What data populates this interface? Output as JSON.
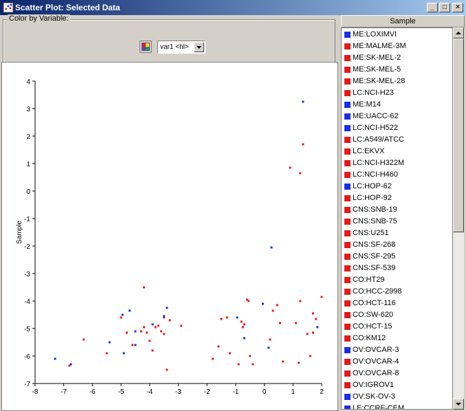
{
  "window": {
    "title": "Scatter Plot: Selected Data",
    "minimize": "_",
    "maximize": "□",
    "close": "×"
  },
  "color_by": {
    "label": "Color by Variable:",
    "selected": "var1 <hl>",
    "icon": "color-palette-icon"
  },
  "colors": {
    "red": "#e31a1a",
    "blue": "#1a2fe6"
  },
  "list": {
    "header": "Sample",
    "items": [
      {
        "label": "ME:LOXIMVI",
        "color": "blue"
      },
      {
        "label": "ME:MALME-3M",
        "color": "red"
      },
      {
        "label": "ME:SK-MEL-2",
        "color": "red"
      },
      {
        "label": "ME:SK-MEL-5",
        "color": "red"
      },
      {
        "label": "ME:SK-MEL-28",
        "color": "red"
      },
      {
        "label": "LC:NCI-H23",
        "color": "red"
      },
      {
        "label": "ME:M14",
        "color": "blue"
      },
      {
        "label": "ME:UACC-62",
        "color": "blue"
      },
      {
        "label": "LC:NCI-H522",
        "color": "blue"
      },
      {
        "label": "LC:A549/ATCC",
        "color": "red"
      },
      {
        "label": "LC:EKVX",
        "color": "red"
      },
      {
        "label": "LC:NCI-H322M",
        "color": "red"
      },
      {
        "label": "LC:NCI-H460",
        "color": "red"
      },
      {
        "label": "LC:HOP-62",
        "color": "blue"
      },
      {
        "label": "LC:HOP-92",
        "color": "red"
      },
      {
        "label": "CNS:SNB-19",
        "color": "red"
      },
      {
        "label": "CNS:SNB-75",
        "color": "red"
      },
      {
        "label": "CNS:U251",
        "color": "red"
      },
      {
        "label": "CNS:SF-268",
        "color": "red"
      },
      {
        "label": "CNS:SF-295",
        "color": "red"
      },
      {
        "label": "CNS:SF-539",
        "color": "red"
      },
      {
        "label": "CO:HT29",
        "color": "red"
      },
      {
        "label": "CO:HCC-2998",
        "color": "red"
      },
      {
        "label": "CO:HCT-116",
        "color": "red"
      },
      {
        "label": "CO:SW-620",
        "color": "red"
      },
      {
        "label": "CO:HCT-15",
        "color": "red"
      },
      {
        "label": "CO:KM12",
        "color": "red"
      },
      {
        "label": "OV:OVCAR-3",
        "color": "blue"
      },
      {
        "label": "OV:OVCAR-4",
        "color": "red"
      },
      {
        "label": "OV:OVCAR-8",
        "color": "red"
      },
      {
        "label": "OV:IGROV1",
        "color": "red"
      },
      {
        "label": "OV:SK-OV-3",
        "color": "blue"
      },
      {
        "label": "LE:CCRF-CEM",
        "color": "blue"
      }
    ]
  },
  "chart_data": {
    "type": "scatter",
    "ylabel": "Sample",
    "xlim": [
      -8,
      2
    ],
    "ylim": [
      -7,
      4
    ],
    "xticks": [
      "-8",
      "-7",
      "-6",
      "-5",
      "-4",
      "-3",
      "-2",
      "-1",
      "0",
      "1",
      "2"
    ],
    "yticks": [
      "4",
      "3",
      "2",
      "1",
      "0",
      "-1",
      "-2",
      "-3",
      "-4",
      "-5",
      "-6",
      "-7"
    ],
    "series": [
      {
        "color": "red",
        "points": [
          [
            -6.8,
            -6.35
          ],
          [
            -6.3,
            -5.4
          ],
          [
            -5.5,
            -5.9
          ],
          [
            -5.0,
            -4.6
          ],
          [
            -4.8,
            -5.15
          ],
          [
            -4.6,
            -5.6
          ],
          [
            -4.3,
            -5.1
          ],
          [
            -4.2,
            -3.5
          ],
          [
            -4.2,
            -4.95
          ],
          [
            -4.1,
            -5.15
          ],
          [
            -4.0,
            -5.45
          ],
          [
            -3.9,
            -5.8
          ],
          [
            -3.8,
            -4.95
          ],
          [
            -3.7,
            -4.9
          ],
          [
            -3.6,
            -5.1
          ],
          [
            -3.5,
            -4.6
          ],
          [
            -3.5,
            -5.2
          ],
          [
            -3.4,
            -6.5
          ],
          [
            -3.3,
            -4.7
          ],
          [
            -2.9,
            -4.9
          ],
          [
            -1.8,
            -6.1
          ],
          [
            -1.6,
            -5.65
          ],
          [
            -1.5,
            -4.65
          ],
          [
            -1.3,
            -4.6
          ],
          [
            -1.2,
            -5.9
          ],
          [
            -0.9,
            -6.3
          ],
          [
            -0.8,
            -4.75
          ],
          [
            -0.75,
            -4.95
          ],
          [
            -0.7,
            -4.85
          ],
          [
            -0.6,
            -3.95
          ],
          [
            -0.55,
            -4.0
          ],
          [
            -0.5,
            -6.0
          ],
          [
            -0.4,
            -6.3
          ],
          [
            0.2,
            -5.4
          ],
          [
            0.3,
            -4.35
          ],
          [
            0.45,
            -4.15
          ],
          [
            0.55,
            -4.8
          ],
          [
            0.65,
            -6.2
          ],
          [
            0.9,
            0.85
          ],
          [
            1.1,
            -4.8
          ],
          [
            1.2,
            -6.25
          ],
          [
            1.25,
            -4.0
          ],
          [
            1.25,
            0.65
          ],
          [
            1.35,
            1.7
          ],
          [
            1.5,
            -5.2
          ],
          [
            1.6,
            -6.0
          ],
          [
            1.7,
            -4.45
          ],
          [
            1.7,
            -5.15
          ],
          [
            1.8,
            -4.65
          ],
          [
            2.0,
            -3.85
          ]
        ]
      },
      {
        "color": "blue",
        "points": [
          [
            -7.3,
            -6.1
          ],
          [
            -6.75,
            -6.3
          ],
          [
            -5.4,
            -5.5
          ],
          [
            -4.95,
            -4.5
          ],
          [
            -4.9,
            -5.9
          ],
          [
            -4.7,
            -4.35
          ],
          [
            -4.5,
            -5.1
          ],
          [
            -4.5,
            -5.6
          ],
          [
            -3.9,
            -4.85
          ],
          [
            -3.9,
            -4.85
          ],
          [
            -3.5,
            -4.55
          ],
          [
            -3.4,
            -4.25
          ],
          [
            -0.95,
            -4.6
          ],
          [
            -0.7,
            -5.35
          ],
          [
            -0.05,
            -4.1
          ],
          [
            0.15,
            -5.7
          ],
          [
            0.25,
            -2.05
          ],
          [
            1.35,
            3.25
          ],
          [
            1.85,
            -4.95
          ]
        ]
      }
    ]
  }
}
